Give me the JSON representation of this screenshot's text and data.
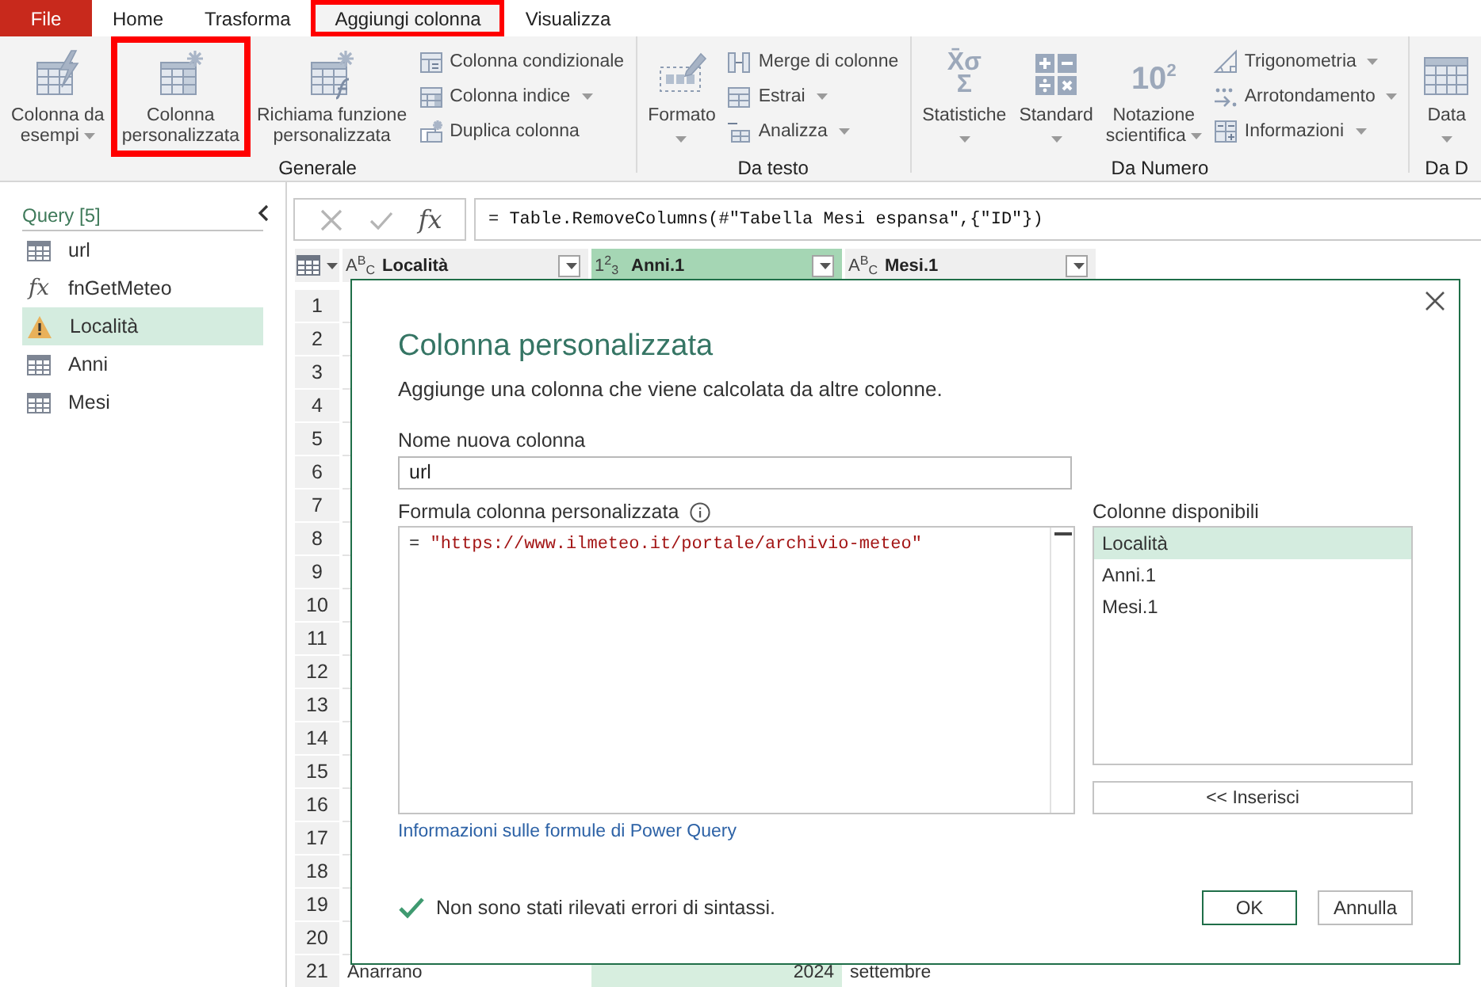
{
  "ribbon_tabs": [
    {
      "label": "File",
      "kind": "file",
      "selected": false,
      "highlighted": false
    },
    {
      "label": "Home",
      "kind": "tab",
      "selected": false,
      "highlighted": false
    },
    {
      "label": "Trasforma",
      "kind": "tab",
      "selected": false,
      "highlighted": false
    },
    {
      "label": "Aggiungi colonna",
      "kind": "tab",
      "selected": true,
      "highlighted": true
    },
    {
      "label": "Visualizza",
      "kind": "tab",
      "selected": false,
      "highlighted": false
    }
  ],
  "ribbon_groups": [
    {
      "label": "Generale",
      "items": [
        {
          "kind": "large",
          "label": "Colonna da\nesempi",
          "dropdown": true,
          "highlighted": false
        },
        {
          "kind": "large",
          "label": "Colonna\npersonalizzata",
          "dropdown": false,
          "highlighted": true
        },
        {
          "kind": "large",
          "label": "Richiama funzione\npersonalizzata",
          "dropdown": false,
          "highlighted": false
        },
        {
          "kind": "stack",
          "items": [
            {
              "label": "Colonna condizionale",
              "dropdown": false
            },
            {
              "label": "Colonna indice",
              "dropdown": true
            },
            {
              "label": "Duplica colonna",
              "dropdown": false
            }
          ]
        }
      ]
    },
    {
      "label": "Da testo",
      "items": [
        {
          "kind": "large",
          "label": "Formato",
          "dropdown": true,
          "highlighted": false
        },
        {
          "kind": "stack",
          "items": [
            {
              "label": "Merge di colonne",
              "dropdown": false
            },
            {
              "label": "Estrai",
              "dropdown": true
            },
            {
              "label": "Analizza",
              "dropdown": true
            }
          ]
        }
      ]
    },
    {
      "label": "Da Numero",
      "items": [
        {
          "kind": "large",
          "label": "Statistiche",
          "icon_text": "X̄σ\nΣ",
          "dropdown": true,
          "highlighted": false
        },
        {
          "kind": "large",
          "label": "Standard",
          "dropdown": true,
          "highlighted": false
        },
        {
          "kind": "large",
          "label": "Notazione\nscientifica",
          "icon_text": "10$^{2}$",
          "dropdown": true,
          "highlighted": false
        },
        {
          "kind": "stack",
          "items": [
            {
              "label": "Trigonometria",
              "dropdown": true
            },
            {
              "label": "Arrotondamento",
              "dropdown": true
            },
            {
              "label": "Informazioni",
              "dropdown": true
            }
          ]
        }
      ]
    },
    {
      "label": "Da D",
      "items": [
        {
          "kind": "large",
          "label": "Data",
          "dropdown": true,
          "highlighted": false
        }
      ]
    }
  ],
  "queries": {
    "title": "Query [5]",
    "items": [
      {
        "name": "url",
        "kind": "table",
        "selected": false
      },
      {
        "name": "fnGetMeteo",
        "kind": "function",
        "symbol": "fx",
        "selected": false
      },
      {
        "name": "Località",
        "kind": "warning",
        "selected": true
      },
      {
        "name": "Anni",
        "kind": "table",
        "selected": false
      },
      {
        "name": "Mesi",
        "kind": "table",
        "selected": false
      }
    ]
  },
  "formula_bar": {
    "fx": "fx",
    "formula": "= Table.RemoveColumns(#\"Tabella Mesi espansa\",{\"ID\"})"
  },
  "table": {
    "columns": [
      {
        "name": "Località",
        "kind": "text",
        "type_symbol": "A$^{B}$$_{C}$",
        "selected": false
      },
      {
        "name": "Anni.1",
        "kind": "number",
        "type_symbol": "1$^{2}$$_{3}$",
        "selected": true
      },
      {
        "name": "Mesi.1",
        "kind": "text",
        "type_symbol": "A$^{B}$$_{C}$",
        "selected": false
      }
    ],
    "rows": [
      {
        "number": "1"
      },
      {
        "number": "2"
      },
      {
        "number": "3"
      },
      {
        "number": "4"
      },
      {
        "number": "5"
      },
      {
        "number": "6"
      },
      {
        "number": "7"
      },
      {
        "number": "8"
      },
      {
        "number": "9"
      },
      {
        "number": "10"
      },
      {
        "number": "11"
      },
      {
        "number": "12"
      },
      {
        "number": "13"
      },
      {
        "number": "14"
      },
      {
        "number": "15"
      },
      {
        "number": "16"
      },
      {
        "number": "17"
      },
      {
        "number": "18"
      },
      {
        "number": "19"
      },
      {
        "number": "20"
      },
      {
        "number": "21",
        "cells": [
          "Anarrano",
          "2024",
          "settembre"
        ]
      }
    ]
  },
  "dialog": {
    "title": "Colonna personalizzata",
    "description": "Aggiunge una colonna che viene calcolata da altre colonne.",
    "name_label": "Nome nuova colonna",
    "name_value": "url",
    "formula_label": "Formula colonna personalizzata",
    "formula": [
      {
        "kind": "operator",
        "text": "="
      },
      {
        "kind": "string",
        "text": "\"https://www.ilmeteo.it/portale/archivio-meteo\""
      }
    ],
    "help_link": "Informazioni sulle formule di Power Query",
    "available_label": "Colonne disponibili",
    "available_columns": [
      {
        "name": "Località",
        "selected": true
      },
      {
        "name": "Anni.1",
        "selected": false
      },
      {
        "name": "Mesi.1",
        "selected": false
      }
    ],
    "insert_button": "<< Inserisci",
    "status": "Non sono stati rilevati errori di sintassi.",
    "buttons": [
      {
        "label": "OK",
        "kind": "primary"
      },
      {
        "label": "Annulla",
        "kind": "secondary"
      }
    ]
  }
}
